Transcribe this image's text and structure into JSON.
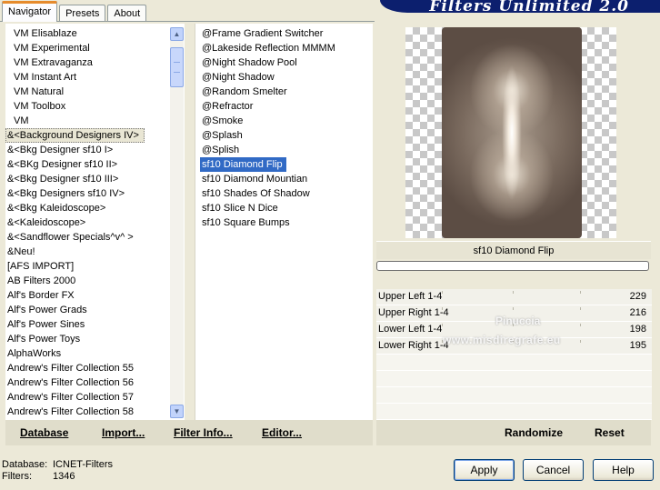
{
  "tabs": [
    "Navigator",
    "Presets",
    "About"
  ],
  "banner_title": "Filters Unlimited 2.0",
  "categories": [
    {
      "label": "VM Elisablaze",
      "indent": true
    },
    {
      "label": "VM Experimental",
      "indent": true
    },
    {
      "label": "VM Extravaganza",
      "indent": true
    },
    {
      "label": "VM Instant Art",
      "indent": true
    },
    {
      "label": "VM Natural",
      "indent": true
    },
    {
      "label": "VM Toolbox",
      "indent": true
    },
    {
      "label": "VM",
      "indent": true
    },
    {
      "label": "&<Background Designers IV>",
      "indent": false,
      "focused": true
    },
    {
      "label": "&<Bkg Designer sf10 I>",
      "indent": false
    },
    {
      "label": "&<BKg Designer sf10 II>",
      "indent": false
    },
    {
      "label": "&<Bkg Designer sf10 III>",
      "indent": false
    },
    {
      "label": "&<Bkg Designers sf10 IV>",
      "indent": false
    },
    {
      "label": "&<Bkg Kaleidoscope>",
      "indent": false
    },
    {
      "label": "&<Kaleidoscope>",
      "indent": false
    },
    {
      "label": "&<Sandflower Specials^v^ >",
      "indent": false
    },
    {
      "label": "&Neu!",
      "indent": false
    },
    {
      "label": "[AFS IMPORT]",
      "indent": false
    },
    {
      "label": "AB Filters 2000",
      "indent": false
    },
    {
      "label": "Alf's Border FX",
      "indent": false
    },
    {
      "label": "Alf's Power Grads",
      "indent": false
    },
    {
      "label": "Alf's Power Sines",
      "indent": false
    },
    {
      "label": "Alf's Power Toys",
      "indent": false
    },
    {
      "label": "AlphaWorks",
      "indent": false
    },
    {
      "label": "Andrew's Filter Collection 55",
      "indent": false
    },
    {
      "label": "Andrew's Filter Collection 56",
      "indent": false
    },
    {
      "label": "Andrew's Filter Collection 57",
      "indent": false
    },
    {
      "label": "Andrew's Filter Collection 58",
      "indent": false
    }
  ],
  "filters": [
    {
      "label": "@Frame Gradient Switcher"
    },
    {
      "label": "@Lakeside Reflection MMMM"
    },
    {
      "label": "@Night Shadow Pool"
    },
    {
      "label": "@Night Shadow"
    },
    {
      "label": "@Random Smelter"
    },
    {
      "label": "@Refractor"
    },
    {
      "label": "@Smoke"
    },
    {
      "label": "@Splash"
    },
    {
      "label": "@Splish"
    },
    {
      "label": "sf10 Diamond Flip",
      "selected": true
    },
    {
      "label": "sf10 Diamond Mountian"
    },
    {
      "label": "sf10 Shades Of Shadow"
    },
    {
      "label": "sf10 Slice N Dice"
    },
    {
      "label": "sf10 Square Bumps"
    }
  ],
  "preview_name": "sf10 Diamond Flip",
  "sliders": [
    {
      "label": "Upper Left 1-4",
      "value": "229"
    },
    {
      "label": "Upper Right 1-4",
      "value": "216"
    },
    {
      "label": "Lower Left 1-4",
      "value": "198"
    },
    {
      "label": "Lower Right 1-4",
      "value": "195"
    }
  ],
  "watermark": {
    "line1": "Pinuccia",
    "line2": "www.misdiregrafe.eu"
  },
  "toolbar": {
    "database": "Database",
    "import": "Import...",
    "filter_info": "Filter Info...",
    "editor": "Editor..."
  },
  "rtoolbar": {
    "randomize": "Randomize",
    "reset": "Reset"
  },
  "info": {
    "database_label": "Database:",
    "database_value": "ICNET-Filters",
    "filters_label": "Filters:",
    "filters_value": "1346"
  },
  "buttons": {
    "apply": "Apply",
    "cancel": "Cancel",
    "help": "Help"
  }
}
